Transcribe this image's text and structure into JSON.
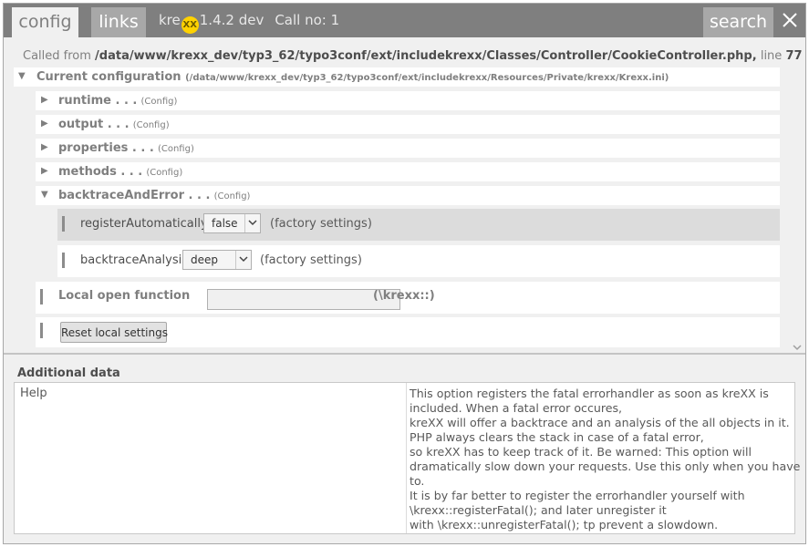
{
  "header": {
    "tabs": [
      {
        "label": "config",
        "active": true
      },
      {
        "label": "links",
        "active": false
      }
    ],
    "brand_prefix": "kre",
    "brand_logo": "XX",
    "version": "1.4.2 dev",
    "call_no": "Call no: 1",
    "search_label": "search",
    "close_icon": "close-icon",
    "colors": {
      "header_bg": "#7f7f7f",
      "tab_inactive": "#a8a8a8",
      "logo": "#ffd200"
    }
  },
  "called_from": {
    "prefix": "Called from",
    "path": "/data/www/krexx_dev/typ3_62/typo3conf/ext/includekrexx/Classes/Controller/CookieController.php,",
    "line_label": "line",
    "line": "77"
  },
  "config": {
    "title": "Current configuration",
    "path": "(/data/www/krexx_dev/typ3_62/typo3conf/ext/includekrexx/Resources/Private/krexx/Krexx.ini)",
    "sections": [
      {
        "name": "runtime . . .",
        "type": "(Config)",
        "expanded": false
      },
      {
        "name": "output . . .",
        "type": "(Config)",
        "expanded": false
      },
      {
        "name": "properties . . .",
        "type": "(Config)",
        "expanded": false
      },
      {
        "name": "methods . . .",
        "type": "(Config)",
        "expanded": false
      },
      {
        "name": "backtraceAndError . . .",
        "type": "(Config)",
        "expanded": true
      }
    ],
    "settings": [
      {
        "label": "registerAutomatically",
        "value": "false",
        "note": "(factory settings)"
      },
      {
        "label": "backtraceAnalysis",
        "value": "deep",
        "note": "(factory settings)"
      }
    ],
    "local_open": {
      "label": "Local open function",
      "value": "",
      "suffix": "(\\krexx::)"
    },
    "reset_label": "Reset local settings"
  },
  "additional": {
    "title": "Additional data",
    "key": "Help",
    "lines": [
      "This option registers the fatal errorhandler as soon as kreXX is",
      "included. When a fatal error occures,",
      "kreXX will offer a backtrace and an analysis of the all objects in it.",
      "PHP always clears the stack in case of a fatal error,",
      "so kreXX has to keep track of it. Be warned: This option will",
      "dramatically slow down your requests. Use this only when you have",
      "to.",
      "It is by far better to register the errorhandler yourself with",
      "\\krexx::registerFatal(); and later unregister it",
      "with \\krexx::unregisterFatal(); tp prevent a slowdown."
    ]
  }
}
